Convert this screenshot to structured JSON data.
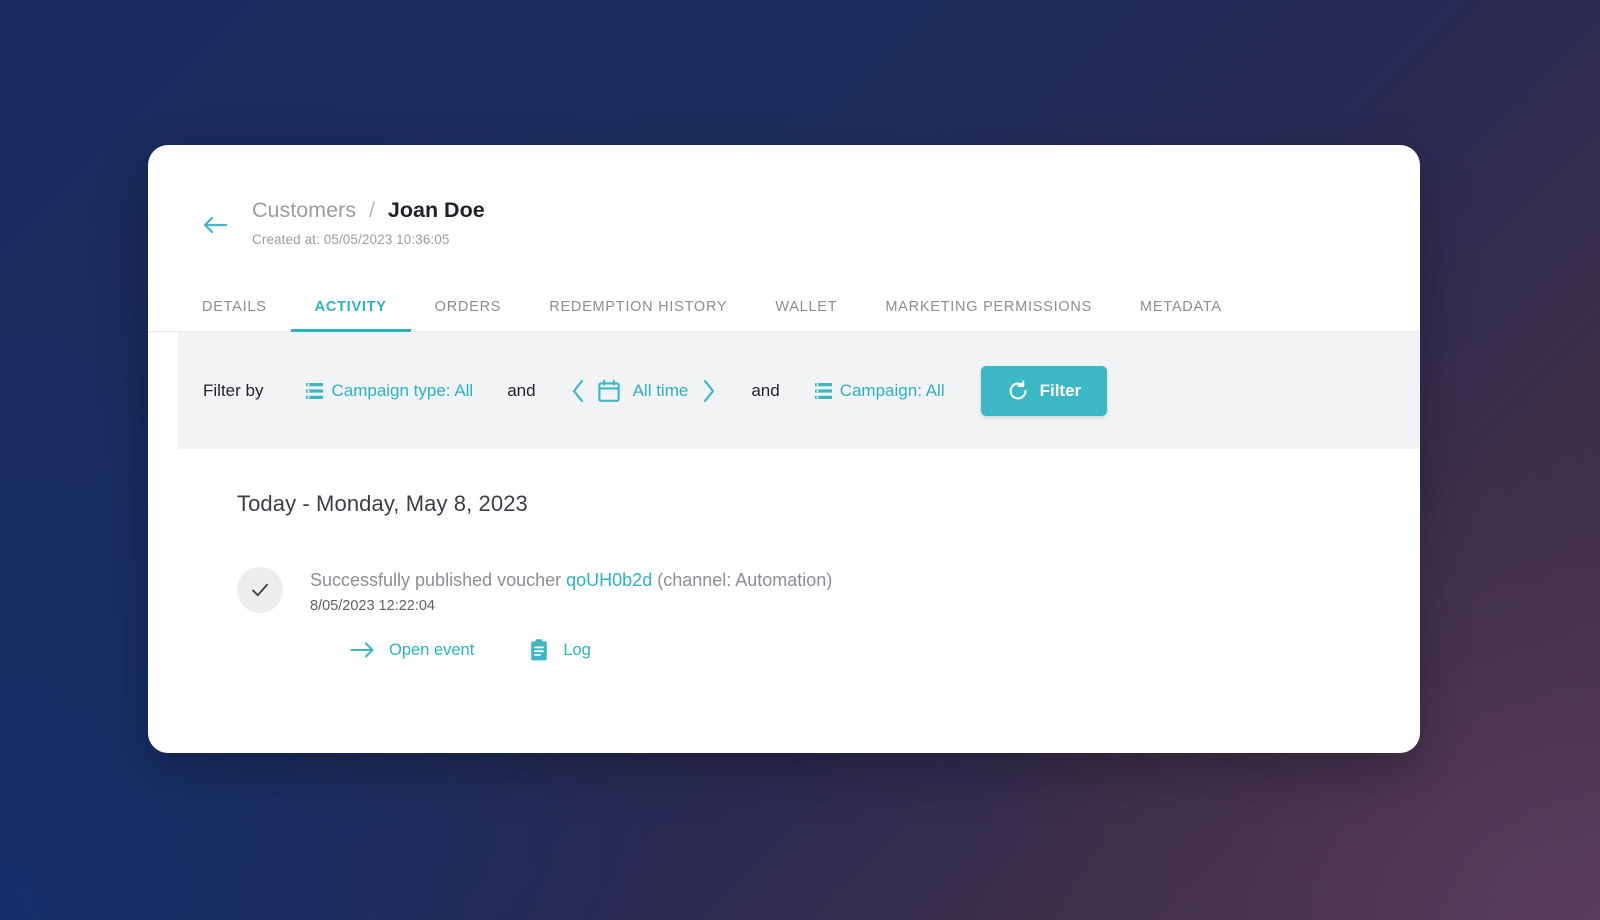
{
  "theme": {
    "accent": "#2bb3c0",
    "button": "#3bb8c3",
    "muted_text": "#8a8f95",
    "dark_text": "#1f2227",
    "filter_bar_bg": "#f2f3f5",
    "background_navy": "#1a2a5e",
    "background_plum": "#4a3550"
  },
  "header": {
    "back_icon": "arrow-left-icon",
    "breadcrumb_parent": "Customers",
    "breadcrumb_separator": "/",
    "breadcrumb_current": "Joan Doe",
    "created_at": "Created at: 05/05/2023 10:36:05"
  },
  "tabs": [
    {
      "label": "DETAILS",
      "active": false
    },
    {
      "label": "ACTIVITY",
      "active": true
    },
    {
      "label": "ORDERS",
      "active": false
    },
    {
      "label": "REDEMPTION HISTORY",
      "active": false
    },
    {
      "label": "WALLET",
      "active": false
    },
    {
      "label": "MARKETING PERMISSIONS",
      "active": false
    },
    {
      "label": "METADATA",
      "active": false
    }
  ],
  "filter_bar": {
    "label": "Filter by",
    "campaign_type": {
      "icon": "filter-list-icon",
      "text": "Campaign type: All"
    },
    "conjunction_1": "and",
    "date_range": {
      "prev_icon": "chevron-left-icon",
      "calendar_icon": "calendar-icon",
      "text": "All time",
      "next_icon": "chevron-right-icon"
    },
    "conjunction_2": "and",
    "campaign": {
      "icon": "filter-list-icon",
      "text": "Campaign: All"
    },
    "filter_button": {
      "icon": "refresh-icon",
      "label": "Filter"
    }
  },
  "activity": {
    "day_heading": "Today - Monday, May 8, 2023",
    "events": [
      {
        "status_icon": "check-icon",
        "title_prefix": "Successfully published voucher ",
        "voucher_code": "qoUH0b2d",
        "title_suffix": " (channel: Automation)",
        "timestamp": "8/05/2023 12:22:04",
        "actions": [
          {
            "icon": "arrow-right-icon",
            "label": "Open event"
          },
          {
            "icon": "clipboard-icon",
            "label": "Log"
          }
        ]
      }
    ]
  }
}
